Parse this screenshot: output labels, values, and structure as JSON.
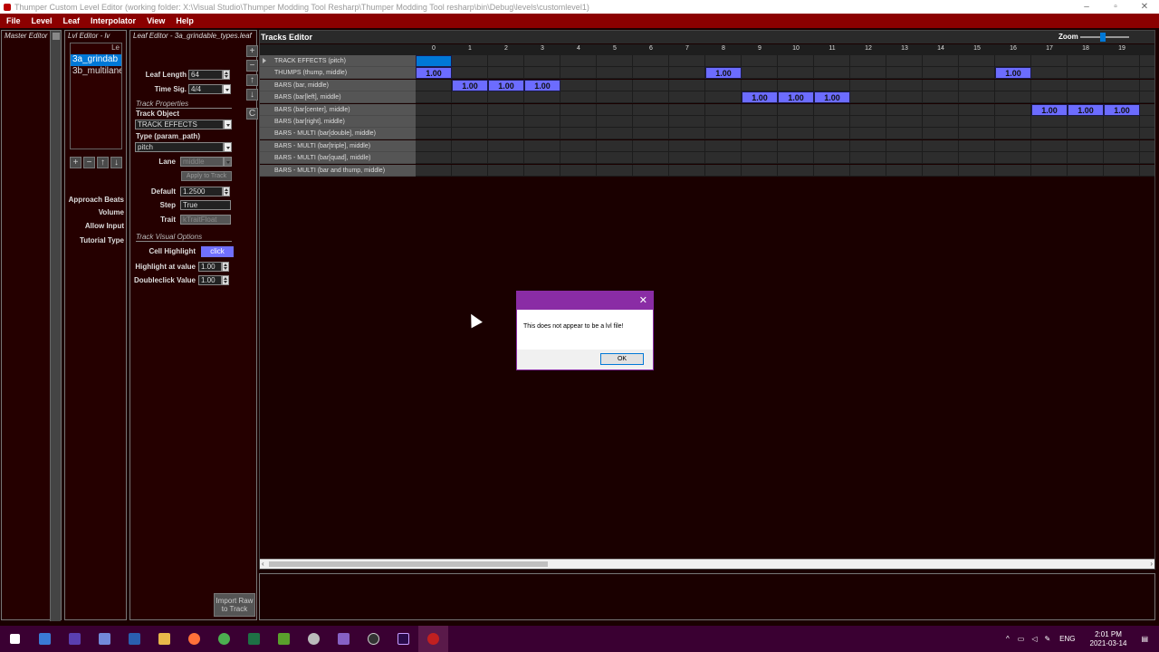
{
  "window": {
    "title": "Thumper Custom Level Editor (working folder: X:\\Visual Studio\\Thumper Modding Tool Resharp\\Thumper Modding Tool resharp\\bin\\Debug\\levels\\customlevel1)",
    "minimize": "–",
    "maximize": "▫",
    "close": "✕"
  },
  "menu": [
    "File",
    "Level",
    "Leaf",
    "Interpolator",
    "View",
    "Help"
  ],
  "master_editor": {
    "title": "Master Editor"
  },
  "lvl_editor": {
    "title": "Lvl Editor - lv",
    "list_header": "Le",
    "items": [
      {
        "label": "3a_grindab",
        "selected": true
      },
      {
        "label": "3b_multilane",
        "selected": false
      }
    ],
    "buttons": [
      "+",
      "−",
      "↑",
      "↓"
    ],
    "labels": [
      "Approach Beats",
      "Volume",
      "Allow Input",
      "Tutorial Type"
    ]
  },
  "leaf_editor": {
    "title": "Leaf Editor - 3a_grindable_types.leaf",
    "leaf_length_label": "Leaf Length",
    "leaf_length": "64",
    "time_sig_label": "Time Sig.",
    "time_sig": "4/4",
    "track_properties": "Track Properties",
    "track_object_label": "Track Object",
    "track_object": "TRACK EFFECTS",
    "type_label": "Type (param_path)",
    "type_value": "pitch",
    "lane_label": "Lane",
    "lane_value": "middle",
    "apply_button": "Apply to Track",
    "default_label": "Default",
    "default_value": "1.2500",
    "step_label": "Step",
    "step_value": "True",
    "trait_label": "Trait",
    "trait_value": "kTraitFloat",
    "visual_options": "Track Visual Options",
    "cell_highlight_label": "Cell Highlight",
    "cell_highlight_button": "click",
    "highlight_value_label": "Highlight at value",
    "highlight_value": "1.00",
    "doubleclick_label": "Doubleclick Value",
    "doubleclick_value": "1.00",
    "import_button": "Import Raw to Track",
    "side_buttons": [
      "+",
      "−",
      "↑",
      "↓",
      "C"
    ]
  },
  "tracks_editor": {
    "title": "Tracks Editor",
    "zoom_label": "Zoom",
    "columns": [
      "0",
      "1",
      "2",
      "3",
      "4",
      "5",
      "6",
      "7",
      "8",
      "9",
      "10",
      "11",
      "12",
      "13",
      "14",
      "15",
      "16",
      "17",
      "18",
      "19"
    ],
    "rows": [
      {
        "label": "TRACK EFFECTS (pitch)",
        "cells": [
          {
            "col": 0,
            "value": "",
            "selected": true
          }
        ]
      },
      {
        "label": "THUMPS (thump, middle)",
        "cells": [
          {
            "col": 0,
            "value": "1.00"
          },
          {
            "col": 8,
            "value": "1.00"
          },
          {
            "col": 16,
            "value": "1.00"
          }
        ]
      },
      {
        "label": "BARS (bar, middle)",
        "cells": [
          {
            "col": 1,
            "value": "1.00"
          },
          {
            "col": 2,
            "value": "1.00"
          },
          {
            "col": 3,
            "value": "1.00"
          }
        ]
      },
      {
        "label": "BARS (bar[left], middle)",
        "cells": [
          {
            "col": 9,
            "value": "1.00"
          },
          {
            "col": 10,
            "value": "1.00"
          },
          {
            "col": 11,
            "value": "1.00"
          }
        ]
      },
      {
        "label": "BARS (bar[center], middle)",
        "cells": [
          {
            "col": 17,
            "value": "1.00"
          },
          {
            "col": 18,
            "value": "1.00"
          },
          {
            "col": 19,
            "value": "1.00"
          }
        ]
      },
      {
        "label": "BARS (bar[right], middle)",
        "cells": []
      },
      {
        "label": "BARS - MULTI (bar[double], middle)",
        "cells": []
      },
      {
        "label": "BARS - MULTI (bar[triple], middle)",
        "cells": []
      },
      {
        "label": "BARS - MULTI (bar[quad], middle)",
        "cells": []
      },
      {
        "label": "BARS - MULTI (bar and thump, middle)",
        "cells": []
      }
    ]
  },
  "dialog": {
    "message": "This does not appear to be a lvl file!",
    "ok": "OK",
    "close": "✕"
  },
  "taskbar": {
    "lang": "ENG",
    "time": "2:01 PM",
    "date": "2021-03-14"
  }
}
